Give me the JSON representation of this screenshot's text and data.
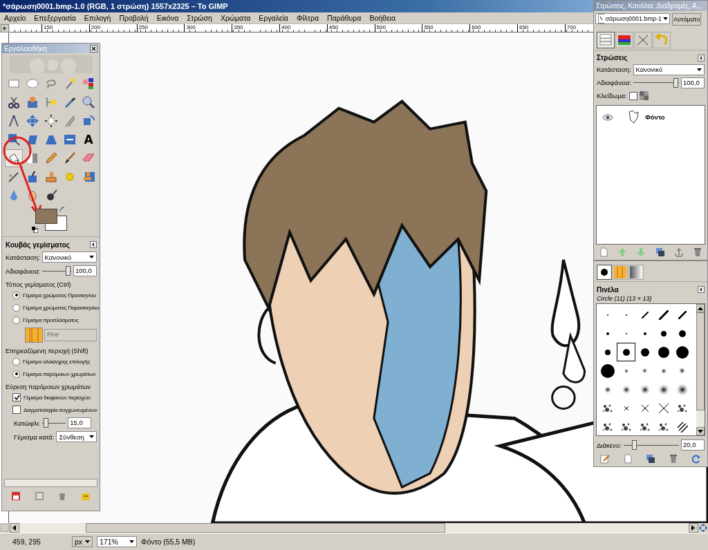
{
  "window": {
    "title": "*σάρωση0001.bmp-1.0 (RGB, 1 στρώση) 1557x2325 – Το GIMP"
  },
  "menu": [
    "Αρχείο",
    "Επεξεργασία",
    "Επιλογή",
    "Προβολή",
    "Εικόνα",
    "Στρώση",
    "Χρώματα",
    "Εργαλεία",
    "Φίλτρα",
    "Παράθυρα",
    "Βοήθεια"
  ],
  "ruler": {
    "ticks": [
      "150",
      "200",
      "250",
      "300",
      "350",
      "400",
      "450",
      "500",
      "550",
      "600",
      "650",
      "700"
    ]
  },
  "toolbox": {
    "title": "Εργαλειοθήκη",
    "tools": [
      {
        "kind": "rect-select",
        "selected": false
      },
      {
        "kind": "ellipse-select",
        "selected": false
      },
      {
        "kind": "lasso",
        "selected": false
      },
      {
        "kind": "wand",
        "selected": false
      },
      {
        "kind": "color-select",
        "selected": false
      },
      {
        "kind": "scissors",
        "selected": false
      },
      {
        "kind": "foreground-select",
        "selected": false
      },
      {
        "kind": "paths",
        "selected": false
      },
      {
        "kind": "color-picker",
        "selected": false
      },
      {
        "kind": "zoom",
        "selected": false
      },
      {
        "kind": "measure",
        "selected": false
      },
      {
        "kind": "move",
        "selected": false
      },
      {
        "kind": "align",
        "selected": false
      },
      {
        "kind": "crop",
        "selected": false
      },
      {
        "kind": "rotate",
        "selected": false
      },
      {
        "kind": "scale",
        "selected": false
      },
      {
        "kind": "shear",
        "selected": false
      },
      {
        "kind": "perspective",
        "selected": false
      },
      {
        "kind": "flip",
        "selected": false
      },
      {
        "kind": "text",
        "label": "A",
        "selected": false
      },
      {
        "kind": "bucket",
        "selected": true
      },
      {
        "kind": "blend",
        "selected": false
      },
      {
        "kind": "pencil",
        "selected": false
      },
      {
        "kind": "paintbrush",
        "selected": false
      },
      {
        "kind": "eraser",
        "selected": false
      },
      {
        "kind": "airbrush",
        "selected": false
      },
      {
        "kind": "ink",
        "selected": false
      },
      {
        "kind": "clone",
        "selected": false
      },
      {
        "kind": "heal",
        "selected": false
      },
      {
        "kind": "perspective-clone",
        "selected": false
      },
      {
        "kind": "blur",
        "selected": false
      },
      {
        "kind": "smudge",
        "selected": false
      },
      {
        "kind": "dodge",
        "selected": false
      }
    ],
    "swatches": [
      {
        "kind": "foreground",
        "color": "#8d765b"
      },
      {
        "kind": "background",
        "color": "#ffffff"
      }
    ]
  },
  "tool_options": {
    "title": "Κουβάς γεμίσματος",
    "mode_label": "Κατάσταση:",
    "mode": "Κανονικό",
    "opacity_label": "Αδιαφάνεια:",
    "opacity": {
      "level": 1
    },
    "opacity_value": "100,0",
    "fill_type_label": "Τύπος γεμίσματος  (Ctrl)",
    "fill_type": [
      {
        "label": "Γέμισμα χρώματος Προσκηνίου",
        "selected": true
      },
      {
        "label": "Γέμισμα χρώματος Παρασκηνίου",
        "selected": false
      },
      {
        "label": "Γέμισμα προπλάσματος",
        "selected": false
      }
    ],
    "pattern": "Pine",
    "affected_label": "Επηρεαζόμενη περιοχή  (Shift)",
    "affected": [
      {
        "label": "Γέμισμα ολόκληρης επιλογής",
        "selected": false
      },
      {
        "label": "Γέμισμα παρόμοιων χρωμάτων",
        "selected": true
      }
    ],
    "find_label": "Εύρεση παρόμοιων χρωμάτων",
    "checks": [
      {
        "label": "Γέμισμα διαφανών περιοχών",
        "checked": true
      },
      {
        "label": "Δειγματοληψία συγχωνευμένων",
        "checked": false
      }
    ],
    "threshold_label": "Κατώφλι:",
    "threshold": {
      "level": 0.06
    },
    "threshold_value": "15,0",
    "fill_by_label": "Γέμισμα κατά:",
    "fill_by": "Σύνθεση"
  },
  "dock": {
    "title": "Στρώσεις, Κανάλια, Διαδρομές, Α...",
    "image": "σάρωση0001.bmp-1",
    "auto_button": "Αυτόματο",
    "tabs": [
      {
        "kind": "layers",
        "selected": true
      },
      {
        "kind": "channels",
        "selected": false
      },
      {
        "kind": "paths",
        "selected": false
      },
      {
        "kind": "undo",
        "selected": false
      }
    ],
    "layers": {
      "title": "Στρώσεις",
      "mode_label": "Κατάσταση:",
      "mode": "Κανονικό",
      "opacity_label": "Αδιαφάνεια:",
      "opacity": {
        "level": 1
      },
      "opacity_value": "100,0",
      "lock_label": "Κλείδωμα:",
      "lock_pixels": false,
      "items": [
        {
          "name": "Φόντο",
          "visible": true
        }
      ]
    },
    "brush_tabs": [
      {
        "kind": "brushes",
        "selected": true
      },
      {
        "kind": "patterns",
        "selected": false
      },
      {
        "kind": "gradients",
        "selected": false
      }
    ],
    "brushes": {
      "title": "Πινέλα",
      "current": "Circle (11) (13 × 13)",
      "items": [
        {
          "kind": "hard",
          "selected": false
        },
        {
          "kind": "hard",
          "selected": false
        },
        {
          "kind": "hard",
          "selected": false
        },
        {
          "kind": "hard",
          "selected": false
        },
        {
          "kind": "hard",
          "selected": false
        },
        {
          "kind": "hard",
          "selected": false
        },
        {
          "kind": "hard",
          "selected": false
        },
        {
          "kind": "hard",
          "selected": false
        },
        {
          "kind": "hard",
          "selected": false
        },
        {
          "kind": "hard",
          "selected": false
        },
        {
          "kind": "hard",
          "selected": false
        },
        {
          "kind": "hard",
          "selected": true
        },
        {
          "kind": "hard",
          "selected": false
        },
        {
          "kind": "hard",
          "selected": false
        },
        {
          "kind": "hard",
          "selected": false
        },
        {
          "kind": "hard",
          "selected": false
        },
        {
          "kind": "soft",
          "selected": false
        },
        {
          "kind": "soft",
          "selected": false
        },
        {
          "kind": "soft",
          "selected": false
        },
        {
          "kind": "soft",
          "selected": false
        },
        {
          "kind": "soft",
          "selected": false
        },
        {
          "kind": "soft",
          "selected": false
        },
        {
          "kind": "soft",
          "selected": false
        },
        {
          "kind": "soft",
          "selected": false
        },
        {
          "kind": "soft",
          "selected": false
        },
        {
          "kind": "texture",
          "selected": false
        },
        {
          "kind": "cross",
          "selected": false
        },
        {
          "kind": "cross",
          "selected": false
        },
        {
          "kind": "cross",
          "selected": false
        },
        {
          "kind": "texture",
          "selected": false
        },
        {
          "kind": "texture",
          "selected": false
        },
        {
          "kind": "texture",
          "selected": false
        },
        {
          "kind": "texture",
          "selected": false
        },
        {
          "kind": "texture",
          "selected": false
        },
        {
          "kind": "stripes",
          "selected": false
        }
      ],
      "spacing_label": "Διάκενο:",
      "spacing": {
        "level": 0.2
      },
      "spacing_value": "20,0"
    }
  },
  "status_bar": {
    "coords": "459, 295",
    "unit": "px",
    "zoom": "171%",
    "info": "Φόντο (55,5 MB)"
  }
}
